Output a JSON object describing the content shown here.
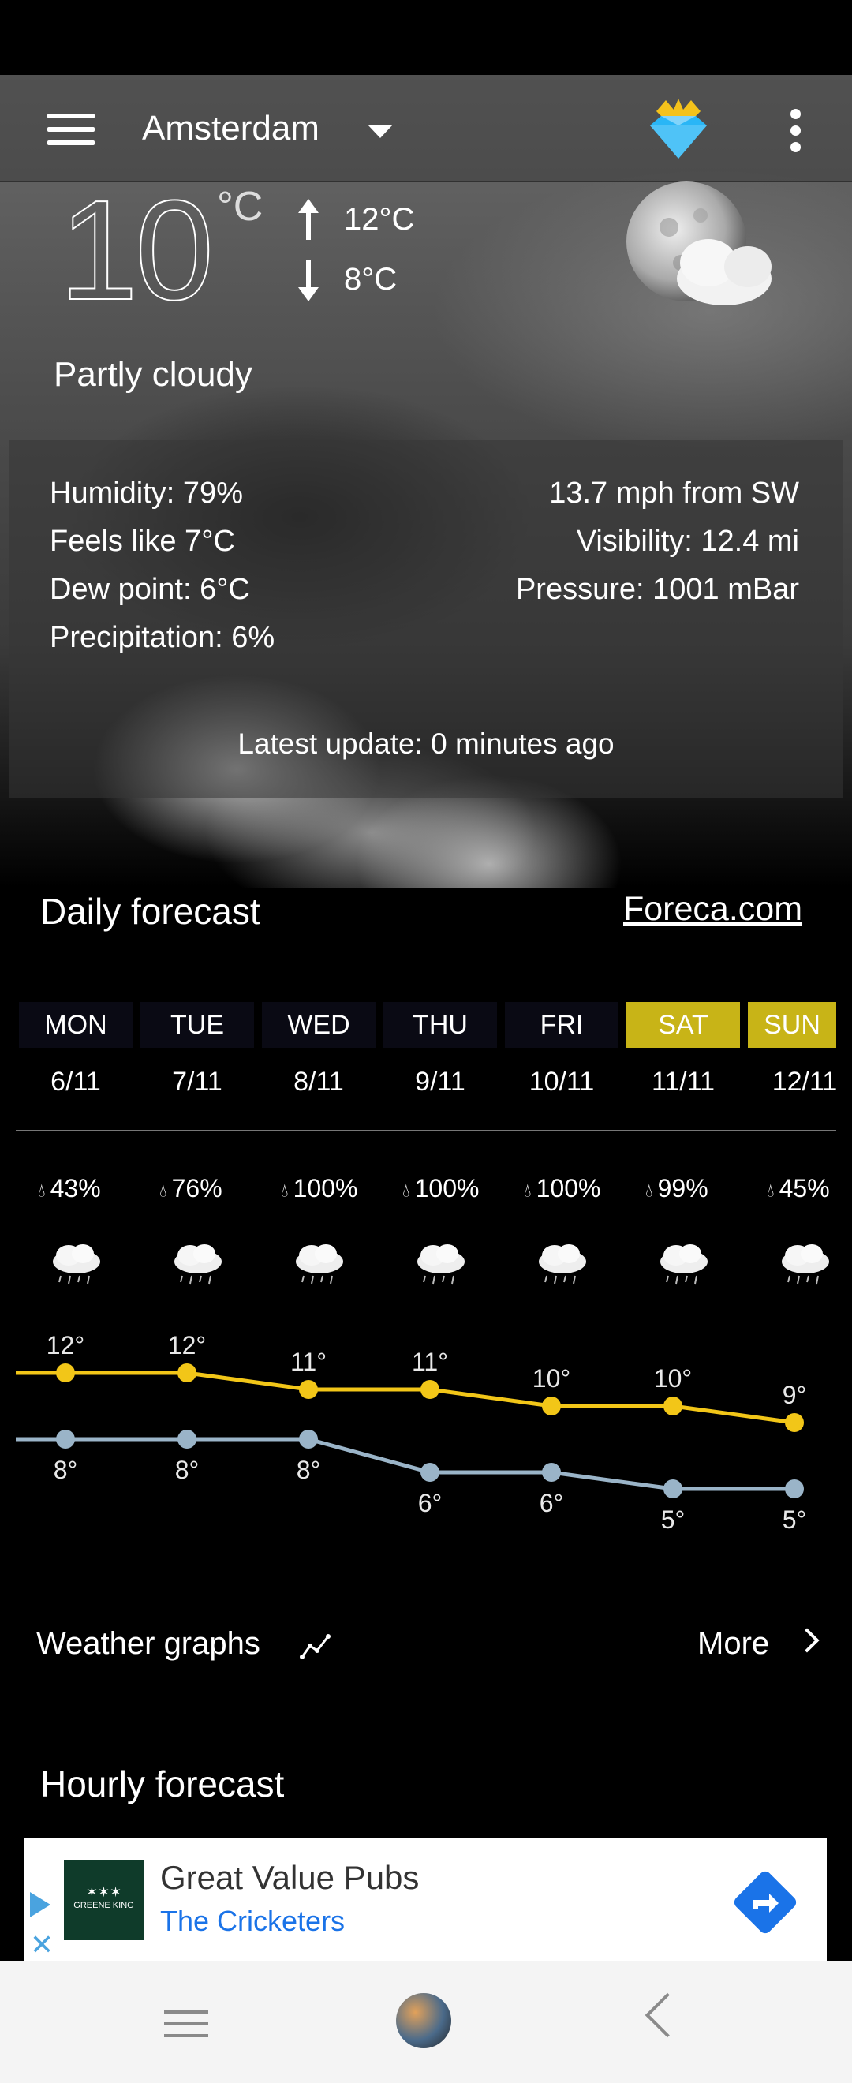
{
  "app_bar": {
    "city": "Amsterdam"
  },
  "current": {
    "temperature": "10",
    "unit": "°C",
    "high": "12°C",
    "low": "8°C",
    "condition": "Partly cloudy"
  },
  "details": {
    "humidity": "Humidity: 79%",
    "feels_like": "Feels like 7°C",
    "dew_point": "Dew point: 6°C",
    "precipitation": "Precipitation: 6%",
    "wind": "13.7 mph from SW",
    "visibility": "Visibility: 12.4 mi",
    "pressure": "Pressure: 1001 mBar",
    "latest_update": "Latest update: 0 minutes ago"
  },
  "daily": {
    "title": "Daily forecast",
    "source_link": "Foreca.com",
    "days": [
      {
        "name": "MON",
        "date": "6/11",
        "precip": "43%",
        "high": "12°",
        "low": "8°",
        "highlight": false
      },
      {
        "name": "TUE",
        "date": "7/11",
        "precip": "76%",
        "high": "12°",
        "low": "8°",
        "highlight": false
      },
      {
        "name": "WED",
        "date": "8/11",
        "precip": "100%",
        "high": "11°",
        "low": "8°",
        "highlight": false
      },
      {
        "name": "THU",
        "date": "9/11",
        "precip": "100%",
        "high": "11°",
        "low": "6°",
        "highlight": false
      },
      {
        "name": "FRI",
        "date": "10/11",
        "precip": "100%",
        "high": "10°",
        "low": "6°",
        "highlight": false
      },
      {
        "name": "SAT",
        "date": "11/11",
        "precip": "99%",
        "high": "10°",
        "low": "5°",
        "highlight": true
      },
      {
        "name": "SUN",
        "date": "12/11",
        "precip": "45%",
        "high": "9°",
        "low": "5°",
        "highlight": true
      }
    ],
    "high_values": [
      12,
      12,
      11,
      11,
      10,
      10,
      9
    ],
    "low_values": [
      8,
      8,
      8,
      6,
      6,
      5,
      5
    ],
    "high_color": "#f2c618",
    "low_color": "#9ab4c8"
  },
  "graphs_row": {
    "label": "Weather graphs",
    "more": "More"
  },
  "hourly": {
    "title": "Hourly forecast"
  },
  "ad": {
    "logo_text": "GREENE KING",
    "title": "Great Value Pubs",
    "subtitle": "The Cricketers"
  },
  "colors": {
    "highlight": "#c8b417",
    "link_blue": "#1a73e8"
  }
}
